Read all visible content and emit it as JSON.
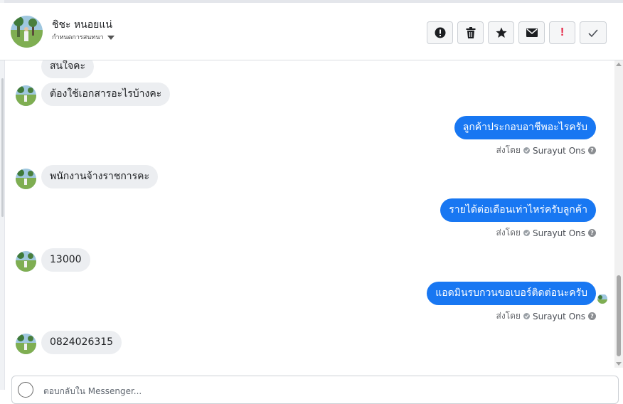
{
  "header": {
    "contact_name": "ชิชะ หนอยแน่",
    "subtitle": "กำหนดการสนทนา",
    "actions": [
      {
        "icon": "alert-circle-icon",
        "label": "report"
      },
      {
        "icon": "trash-icon",
        "label": "delete"
      },
      {
        "icon": "star-icon",
        "label": "star"
      },
      {
        "icon": "envelope-icon",
        "label": "mark unread"
      },
      {
        "icon": "red-exclamation-icon",
        "label": "!"
      },
      {
        "icon": "checkmark-icon",
        "label": "done"
      }
    ]
  },
  "messages": [
    {
      "direction": "in",
      "text": "สนใจคะ"
    },
    {
      "direction": "in",
      "text": "ต้องใช้เอกสารอะไรบ้างคะ"
    },
    {
      "direction": "out",
      "text": "ลูกค้าประกอบอาชีพอะไรครับ",
      "sent_by_prefix": "ส่งโดย",
      "agent": "Surayut Ons"
    },
    {
      "direction": "in",
      "text": "พนักงานจ้างราชการคะ"
    },
    {
      "direction": "out",
      "text": "รายได้ต่อเดือนเท่าไหร่ครับลูกค้า",
      "sent_by_prefix": "ส่งโดย",
      "agent": "Surayut Ons"
    },
    {
      "direction": "in",
      "text": "13000"
    },
    {
      "direction": "out",
      "text": "แอดมินรบกวนขอเบอร์ติดต่อนะครับ",
      "sent_by_prefix": "ส่งโดย",
      "agent": "Surayut Ons"
    },
    {
      "direction": "in",
      "text": "0824026315"
    }
  ],
  "composer": {
    "placeholder": "ตอบกลับใน Messenger..."
  },
  "colors": {
    "outgoing_bubble": "#1877f2",
    "incoming_bubble": "#eceef1",
    "alert_red": "#e41e3f"
  }
}
